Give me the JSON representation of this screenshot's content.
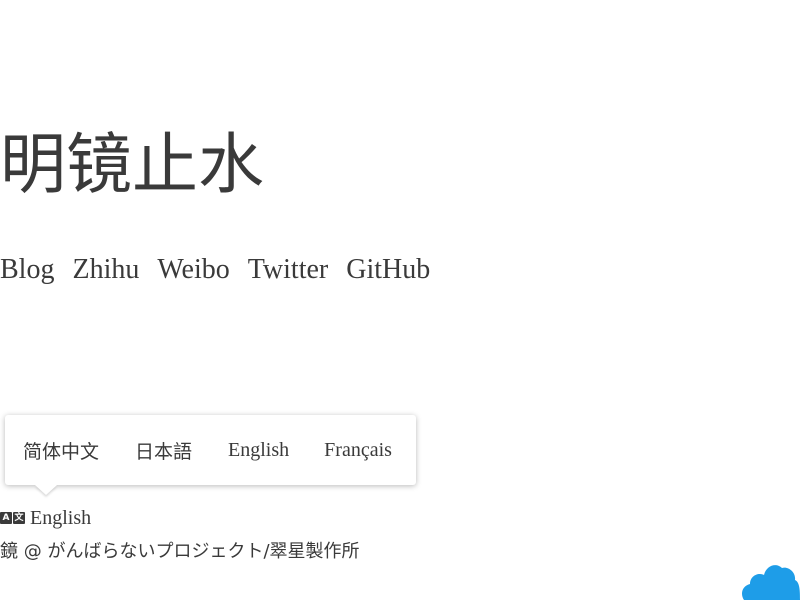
{
  "site": {
    "title": "明镜止水"
  },
  "nav": {
    "items": [
      {
        "label": "Blog"
      },
      {
        "label": "Zhihu"
      },
      {
        "label": "Weibo"
      },
      {
        "label": "Twitter"
      },
      {
        "label": "GitHub"
      }
    ]
  },
  "language_menu": {
    "options": [
      {
        "label": "简体中文"
      },
      {
        "label": "日本語"
      },
      {
        "label": "English"
      },
      {
        "label": "Français"
      }
    ]
  },
  "language_switch": {
    "icon": "translate-icon",
    "current": "English"
  },
  "footer": {
    "text": "鏡 @ がんばらないプロジェクト/翠星製作所"
  },
  "colors": {
    "text": "#3a3a3a",
    "cloud": "#1e9de8"
  }
}
